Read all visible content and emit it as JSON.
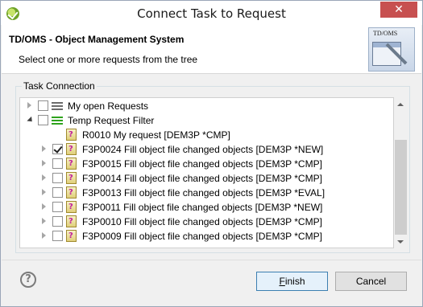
{
  "window": {
    "title": "Connect Task to Request",
    "close_label": "✕"
  },
  "banner": {
    "title": "TD/OMS - Object Management System",
    "description": "Select one or more requests from the tree",
    "image_label": "TD/OMS"
  },
  "group": {
    "legend": "Task Connection"
  },
  "tree": {
    "items": [
      {
        "label": "My open Requests",
        "level": 0,
        "twisty": "collapsed",
        "checked": false,
        "icon": "filter-icon"
      },
      {
        "label": "Temp Request Filter",
        "level": 0,
        "twisty": "expanded",
        "checked": false,
        "icon": "filter-icon-green"
      },
      {
        "label": "R0010 My request [DEM3P *CMP]",
        "level": 1,
        "twisty": "none",
        "checked": null,
        "icon": "request-icon"
      },
      {
        "label": "F3P0024 Fill object file changed objects [DEM3P *NEW]",
        "level": 1,
        "twisty": "collapsed",
        "checked": true,
        "icon": "request-icon"
      },
      {
        "label": "F3P0015 Fill object file changed objects [DEM3P *CMP]",
        "level": 1,
        "twisty": "collapsed",
        "checked": false,
        "icon": "request-icon"
      },
      {
        "label": "F3P0014 Fill object file changed objects [DEM3P *CMP]",
        "level": 1,
        "twisty": "collapsed",
        "checked": false,
        "icon": "request-icon"
      },
      {
        "label": "F3P0013 Fill object file changed objects [DEM3P *EVAL]",
        "level": 1,
        "twisty": "collapsed",
        "checked": false,
        "icon": "request-icon"
      },
      {
        "label": "F3P0011 Fill object file changed objects [DEM3P *NEW]",
        "level": 1,
        "twisty": "collapsed",
        "checked": false,
        "icon": "request-icon"
      },
      {
        "label": "F3P0010 Fill object file changed objects [DEM3P *CMP]",
        "level": 1,
        "twisty": "collapsed",
        "checked": false,
        "icon": "request-icon"
      },
      {
        "label": "F3P0009 Fill object file changed objects [DEM3P *CMP]",
        "level": 1,
        "twisty": "collapsed",
        "checked": false,
        "icon": "request-icon"
      }
    ]
  },
  "footer": {
    "help_label": "?",
    "finish_mnemonic": "F",
    "finish_rest": "inish",
    "cancel_label": "Cancel"
  }
}
